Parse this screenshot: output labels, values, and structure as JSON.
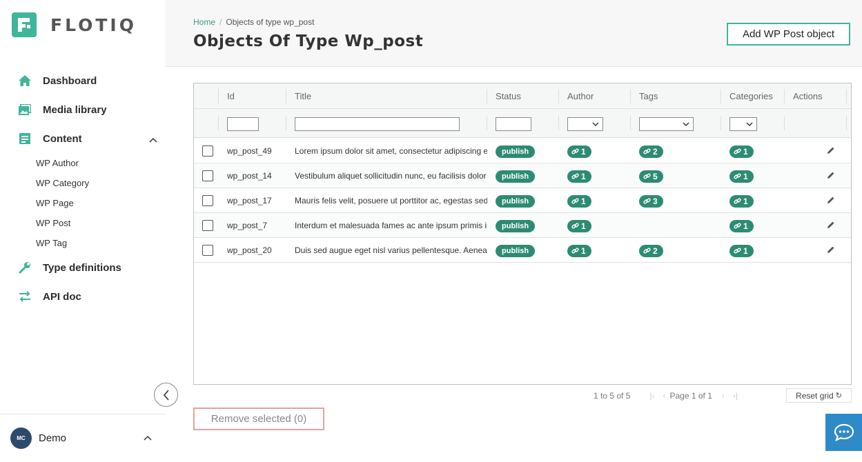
{
  "brand": {
    "name": "FLOTIQ"
  },
  "colors": {
    "accent": "#3fb59a",
    "badge": "#2e8b73",
    "remove_border": "#e8a0a0",
    "chat": "#2e8bc8"
  },
  "sidebar": {
    "items": [
      {
        "label": "Dashboard",
        "icon": "home-icon"
      },
      {
        "label": "Media library",
        "icon": "image-icon"
      },
      {
        "label": "Content",
        "icon": "document-icon",
        "expanded": true,
        "children": [
          "WP Author",
          "WP Category",
          "WP Page",
          "WP Post",
          "WP Tag"
        ]
      },
      {
        "label": "Type definitions",
        "icon": "wrench-icon"
      },
      {
        "label": "API doc",
        "icon": "swap-arrows-icon"
      }
    ],
    "user": {
      "initials": "MC",
      "name": "Demo"
    }
  },
  "header": {
    "breadcrumb": {
      "home": "Home",
      "current": "Objects of type wp_post"
    },
    "title": "Objects Of Type Wp_post",
    "add_button": "Add WP Post object"
  },
  "grid": {
    "columns": [
      "Id",
      "Title",
      "Status",
      "Author",
      "Tags",
      "Categories",
      "Actions"
    ],
    "rows": [
      {
        "id": "wp_post_49",
        "title": "Lorem ipsum dolor sit amet, consectetur adipiscing elit",
        "status": "publish",
        "author": "1",
        "tags": "2",
        "categories": "1"
      },
      {
        "id": "wp_post_14",
        "title": "Vestibulum aliquet sollicitudin nunc, eu facilisis dolor",
        "status": "publish",
        "author": "1",
        "tags": "5",
        "categories": "1"
      },
      {
        "id": "wp_post_17",
        "title": "Mauris felis velit, posuere ut porttitor ac, egestas sed",
        "status": "publish",
        "author": "1",
        "tags": "3",
        "categories": "1"
      },
      {
        "id": "wp_post_7",
        "title": "Interdum et malesuada fames ac ante ipsum primis in",
        "status": "publish",
        "author": "1",
        "tags": "",
        "categories": "1"
      },
      {
        "id": "wp_post_20",
        "title": "Duis sed augue eget nisl varius pellentesque. Aenean",
        "status": "publish",
        "author": "1",
        "tags": "2",
        "categories": "1"
      }
    ]
  },
  "pagination": {
    "range": "1 to 5 of 5",
    "page_label": "Page 1 of 1",
    "reset": "Reset grid"
  },
  "remove_button": "Remove selected (0)"
}
